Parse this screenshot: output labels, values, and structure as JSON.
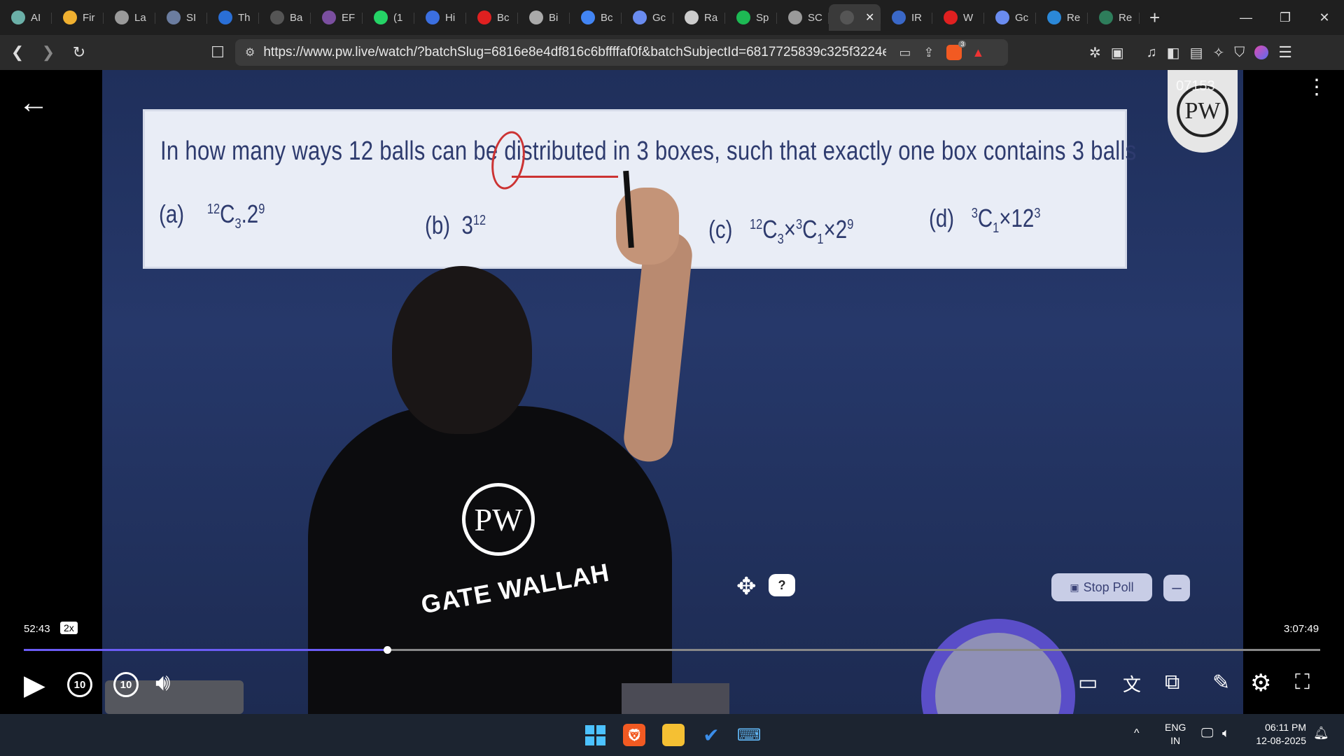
{
  "browser": {
    "tabs": [
      {
        "label": "AI",
        "color": "#6bb0a8"
      },
      {
        "label": "Fir",
        "color": "#f0b030"
      },
      {
        "label": "La",
        "color": "#9a9a9a"
      },
      {
        "label": "SI",
        "color": "#6b7da0"
      },
      {
        "label": "Th",
        "color": "#2a6fd6"
      },
      {
        "label": "Ba",
        "color": "#555555"
      },
      {
        "label": "EF",
        "color": "#7b4fa0"
      },
      {
        "label": "(1",
        "color": "#25d366"
      },
      {
        "label": "Hi",
        "color": "#3b6fe0"
      },
      {
        "label": "Bc",
        "color": "#e02020"
      },
      {
        "label": "Bi",
        "color": "#aaaaaa"
      },
      {
        "label": "Bc",
        "color": "#4285f4"
      },
      {
        "label": "Gc",
        "color": "#6a8cf0"
      },
      {
        "label": "Ra",
        "color": "#cccccc"
      },
      {
        "label": "Sp",
        "color": "#1db954"
      },
      {
        "label": "SC",
        "color": "#9a9a9a"
      },
      {
        "label": "",
        "color": "#555555",
        "active": true
      },
      {
        "label": "IR",
        "color": "#3a68c8"
      },
      {
        "label": "W",
        "color": "#e02020"
      },
      {
        "label": "Gc",
        "color": "#6a8cf0"
      },
      {
        "label": "Re",
        "color": "#2b88d8"
      },
      {
        "label": "Re",
        "color": "#2e7d5b"
      }
    ],
    "active_tab_close": "✕",
    "new_tab": "+",
    "url": "https://www.pw.live/watch/?batchSlug=6816e8e4df816c6bffffaf0f&batchSubjectId=6817725839c325f3224e28d...",
    "brave_badge": "3"
  },
  "whiteboard": {
    "question": "In how many ways 12 balls can be distributed in 3 boxes, such that exactly one box contains 3 balls",
    "options": [
      {
        "label": "(a)",
        "pre": "12",
        "base": "C",
        "sub": "3",
        "rest": ".2",
        "sup": "9"
      },
      {
        "label": "(b)",
        "base": "3",
        "sup": "12"
      },
      {
        "label": "(c)",
        "pre": "12",
        "base": "C",
        "sub": "3",
        "mid_pre": "3",
        "mid": "C",
        "mid_sub": "1",
        "rest": "2",
        "sup": "9"
      },
      {
        "label": "(d)",
        "pre": "3",
        "base": "C",
        "sub": "1",
        "rest": "12",
        "sup": "3"
      }
    ],
    "op_times": "×",
    "pw_mark": "PW",
    "pw_count": "07153"
  },
  "shirt": {
    "logo": "PW",
    "text": "GATE WALLAH"
  },
  "poll": {
    "stop_label": "Stop Poll",
    "minus": "–",
    "help": "?"
  },
  "player": {
    "current_time": "52:43",
    "speed": "2x",
    "total_time": "3:07:49",
    "progress_fraction": 0.28,
    "skip_back": "10",
    "skip_forward": "10"
  },
  "taskbar": {
    "lang": "ENG",
    "region": "IN",
    "time": "06:11 PM",
    "date": "12-08-2025"
  }
}
